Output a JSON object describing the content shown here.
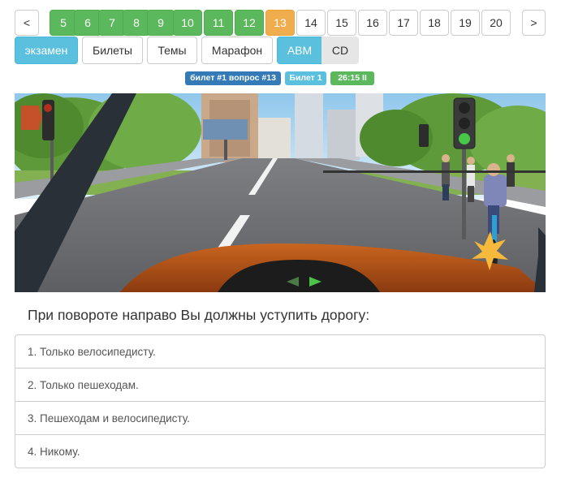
{
  "pager": {
    "prev_label": "<",
    "next_label": ">",
    "pages": [
      {
        "label": "5",
        "state": "done"
      },
      {
        "label": "6",
        "state": "done"
      },
      {
        "label": "7",
        "state": "done"
      },
      {
        "label": "8",
        "state": "done"
      },
      {
        "label": "9",
        "state": "done"
      },
      {
        "label": "10",
        "state": "done"
      },
      {
        "label": "11",
        "state": "done"
      },
      {
        "label": "12",
        "state": "done"
      },
      {
        "label": "13",
        "state": "current"
      },
      {
        "label": "14",
        "state": "pending"
      },
      {
        "label": "15",
        "state": "pending"
      },
      {
        "label": "16",
        "state": "pending"
      },
      {
        "label": "17",
        "state": "pending"
      },
      {
        "label": "18",
        "state": "pending"
      },
      {
        "label": "19",
        "state": "pending"
      },
      {
        "label": "20",
        "state": "pending"
      }
    ]
  },
  "modes": {
    "exam": "экзамен",
    "tickets": "Билеты",
    "topics": "Темы",
    "marathon": "Марафон",
    "category_abm": "ABM",
    "category_cd": "CD"
  },
  "badges": {
    "ticket_question": "билет #1 вопрос #13",
    "ticket": "Билет 1",
    "timer": "26:15 II"
  },
  "colors": {
    "done": "#5cb85c",
    "current": "#f0ad4e",
    "active": "#5bc0de",
    "badge_primary": "#337ab7"
  },
  "question": {
    "text": "При повороте направо Вы должны уступить дорогу:"
  },
  "answers": [
    {
      "text": "1. Только велосипедисту."
    },
    {
      "text": "2. Только пешеходам."
    },
    {
      "text": "3. Пешеходам и велосипедисту."
    },
    {
      "text": "4. Никому."
    }
  ]
}
